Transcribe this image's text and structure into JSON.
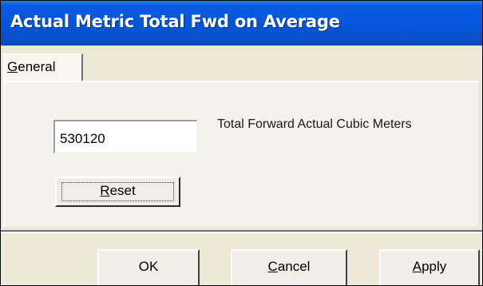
{
  "window": {
    "title": "Actual Metric Total Fwd on Average"
  },
  "tabs": [
    {
      "label": "General",
      "mnemonic": "G",
      "rest": "eneral",
      "active": true
    }
  ],
  "general": {
    "value_field": {
      "value": "530120"
    },
    "value_label": "Total Forward Actual Cubic Meters",
    "reset_button": {
      "label": "Reset",
      "mnemonic": "R",
      "rest": "eset"
    }
  },
  "footer": {
    "ok_label": "OK",
    "cancel": {
      "label": "Cancel",
      "mnemonic": "C",
      "rest": "ancel"
    },
    "apply": {
      "label": "Apply",
      "mnemonic": "A",
      "rest": "pply"
    }
  },
  "colors": {
    "titlebar": "#0555d8",
    "dialog_background": "#ece9d8",
    "panel_background": "#f3f2ec",
    "title_text": "#ffffff"
  }
}
